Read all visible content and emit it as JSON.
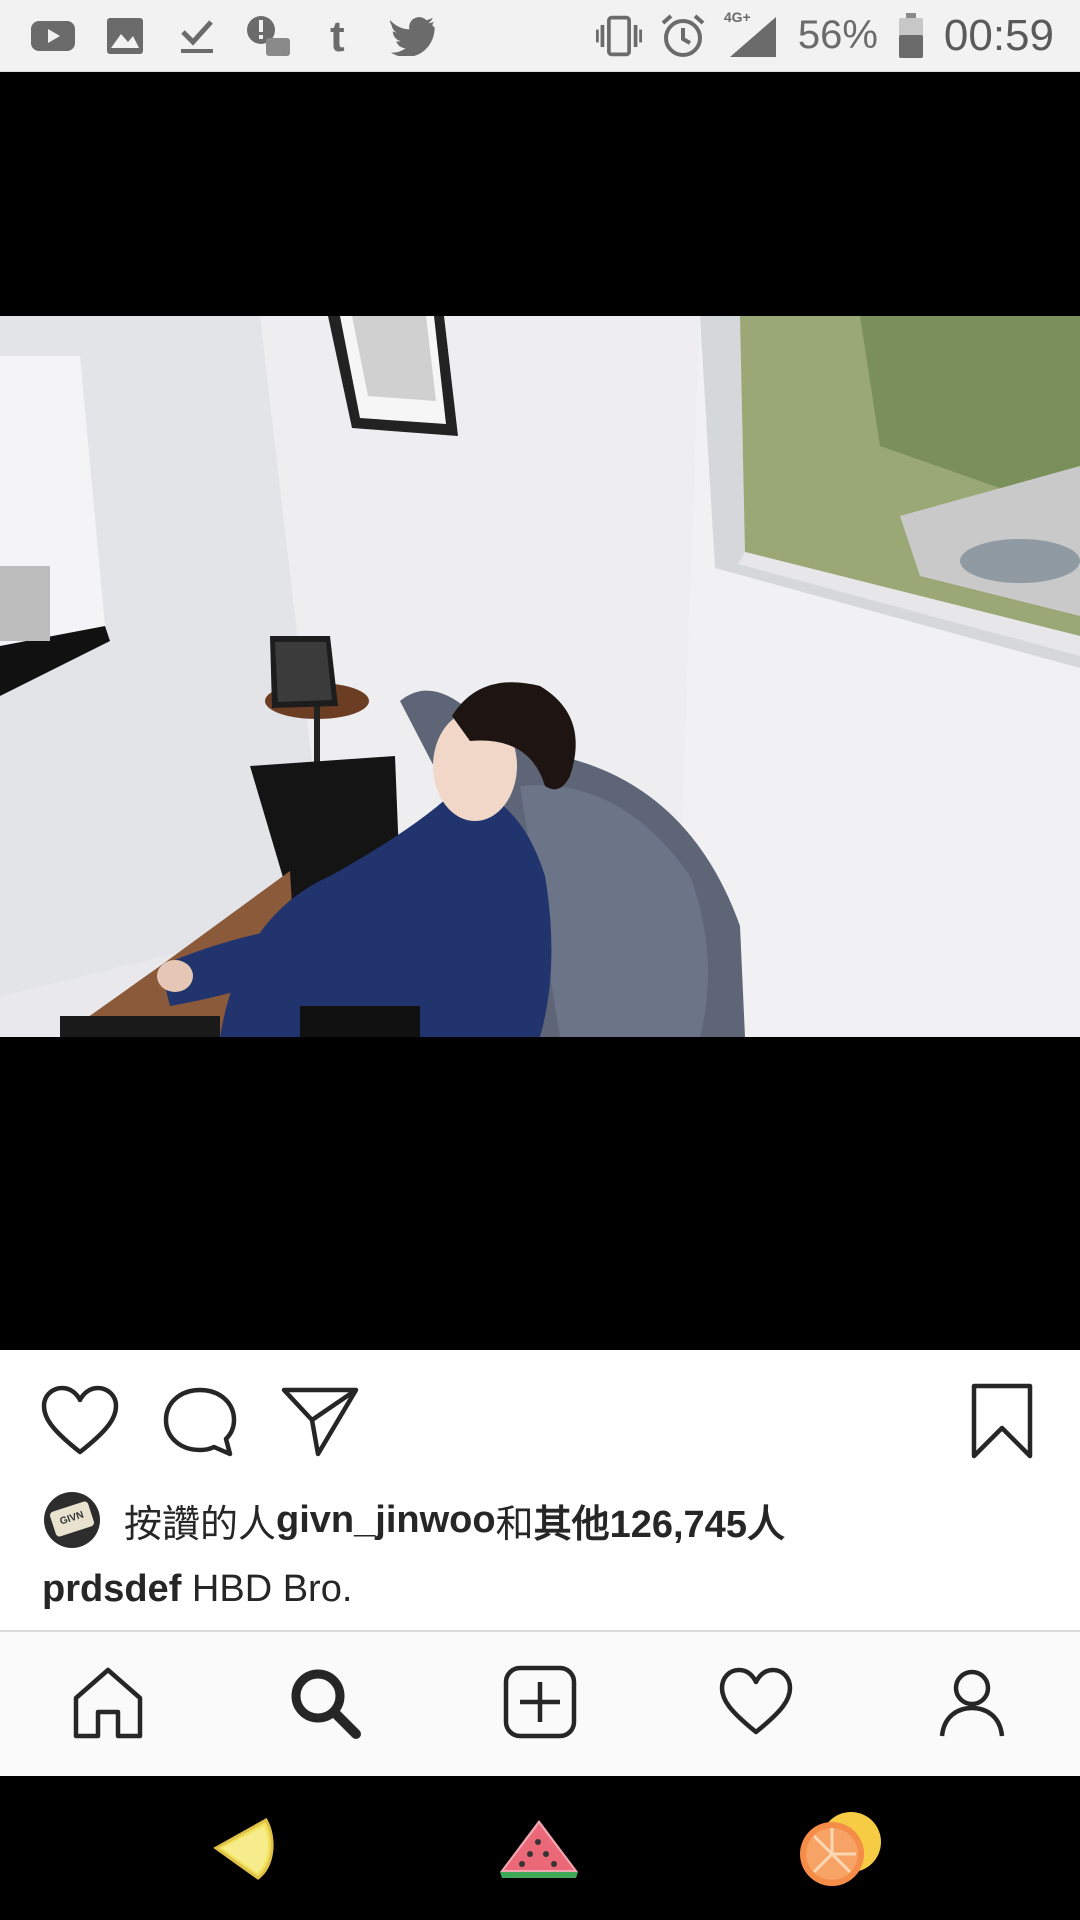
{
  "status_bar": {
    "battery": "56%",
    "time": "00:59",
    "network": "4G+",
    "left_icons": [
      "youtube-icon",
      "gallery-icon",
      "download-done-icon",
      "alert-icon",
      "tumblr-icon",
      "twitter-icon"
    ],
    "right_icons": [
      "vibrate-icon",
      "alarm-icon",
      "signal-icon",
      "battery-icon"
    ]
  },
  "post": {
    "image_alt": "",
    "likes_prefix": "按讚的人 ",
    "likes_user": "givn_jinwoo",
    "likes_conjunction": "和",
    "likes_suffix": "其他126,745人",
    "caption_user": "prdsdef",
    "caption_text": " HBD Bro.",
    "avatar_tag": "GIVN"
  },
  "actions": [
    "heart-icon",
    "comment-icon",
    "share-icon",
    "bookmark-icon"
  ],
  "bottom_nav": [
    "home-icon",
    "search-icon",
    "new-post-icon",
    "activity-icon",
    "profile-icon"
  ],
  "system_bar": [
    "lemon-icon",
    "watermelon-icon",
    "orange-icon"
  ],
  "colors": {
    "text": "#262626",
    "statusbar_bg": "#f2f2f2",
    "nav_bg": "#fafafa",
    "photo_bg": "#000000"
  }
}
